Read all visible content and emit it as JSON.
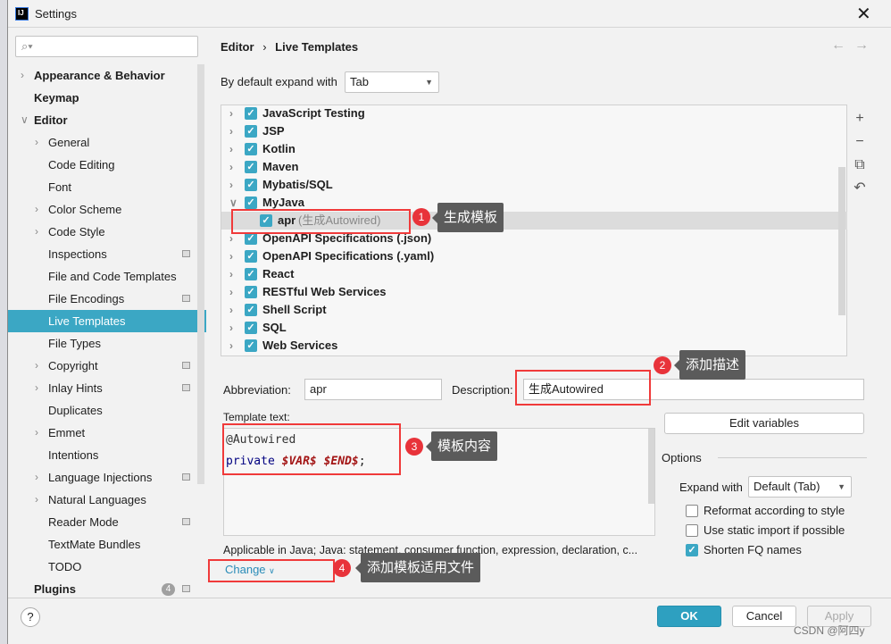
{
  "window": {
    "title": "Settings"
  },
  "sidebar": {
    "search_placeholder": "",
    "items": [
      {
        "label": "Appearance & Behavior",
        "level": 0,
        "bold": true,
        "chevron": true
      },
      {
        "label": "Keymap",
        "level": 0,
        "bold": true
      },
      {
        "label": "Editor",
        "level": 0,
        "bold": true,
        "expanded": true
      },
      {
        "label": "General",
        "level": 1,
        "chevron": true
      },
      {
        "label": "Code Editing",
        "level": 1
      },
      {
        "label": "Font",
        "level": 1
      },
      {
        "label": "Color Scheme",
        "level": 1,
        "chevron": true
      },
      {
        "label": "Code Style",
        "level": 1,
        "chevron": true
      },
      {
        "label": "Inspections",
        "level": 1,
        "cfg": true
      },
      {
        "label": "File and Code Templates",
        "level": 1
      },
      {
        "label": "File Encodings",
        "level": 1,
        "cfg": true
      },
      {
        "label": "Live Templates",
        "level": 1,
        "selected": true
      },
      {
        "label": "File Types",
        "level": 1
      },
      {
        "label": "Copyright",
        "level": 1,
        "chevron": true,
        "cfg": true
      },
      {
        "label": "Inlay Hints",
        "level": 1,
        "chevron": true,
        "cfg": true
      },
      {
        "label": "Duplicates",
        "level": 1
      },
      {
        "label": "Emmet",
        "level": 1,
        "chevron": true
      },
      {
        "label": "Intentions",
        "level": 1
      },
      {
        "label": "Language Injections",
        "level": 1,
        "chevron": true,
        "cfg": true
      },
      {
        "label": "Natural Languages",
        "level": 1,
        "chevron": true
      },
      {
        "label": "Reader Mode",
        "level": 1,
        "cfg": true
      },
      {
        "label": "TextMate Bundles",
        "level": 1
      },
      {
        "label": "TODO",
        "level": 1
      },
      {
        "label": "Plugins",
        "level": 0,
        "bold": true,
        "cfg": true,
        "count": "4"
      }
    ]
  },
  "breadcrumb": {
    "parent": "Editor",
    "current": "Live Templates"
  },
  "expand": {
    "label": "By default expand with",
    "value": "Tab"
  },
  "tree": [
    {
      "label": "JavaScript Testing"
    },
    {
      "label": "JSP"
    },
    {
      "label": "Kotlin"
    },
    {
      "label": "Maven"
    },
    {
      "label": "Mybatis/SQL"
    },
    {
      "label": "MyJava",
      "expanded": true
    },
    {
      "label": "apr",
      "desc": "(生成Autowired)",
      "child": true
    },
    {
      "label": "OpenAPI Specifications (.json)"
    },
    {
      "label": "OpenAPI Specifications (.yaml)"
    },
    {
      "label": "React"
    },
    {
      "label": "RESTful Web Services"
    },
    {
      "label": "Shell Script"
    },
    {
      "label": "SQL"
    },
    {
      "label": "Web Services"
    }
  ],
  "form": {
    "abbr_label": "Abbreviation:",
    "abbr_value": "apr",
    "desc_label": "Description:",
    "desc_value": "生成Autowired",
    "template_label": "Template text:",
    "code_line1": "@Autowired",
    "code_kw": "private",
    "code_var1": "$VAR$",
    "code_var2": "$END$",
    "code_end": ";",
    "edit_vars": "Edit variables",
    "applicable": "Applicable in Java; Java: statement, consumer function, expression, declaration, c...",
    "change": "Change"
  },
  "options": {
    "title": "Options",
    "expand_label": "Expand with",
    "expand_value": "Default (Tab)",
    "reformat": "Reformat according to style",
    "reformat_checked": false,
    "static_import": "Use static import if possible",
    "static_checked": false,
    "shorten": "Shorten FQ names",
    "shorten_checked": true
  },
  "annotations": [
    {
      "n": "1",
      "text": "生成模板"
    },
    {
      "n": "2",
      "text": "添加描述"
    },
    {
      "n": "3",
      "text": "模板内容"
    },
    {
      "n": "4",
      "text": "添加模板适用文件"
    }
  ],
  "footer": {
    "ok": "OK",
    "cancel": "Cancel",
    "apply": "Apply",
    "watermark": "CSDN @阿四y",
    "help": "?"
  },
  "colors": {
    "accent": "#3ba7c4",
    "annotation_red": "#f03a3a",
    "keyword": "#000080",
    "variable": "#a31515"
  }
}
